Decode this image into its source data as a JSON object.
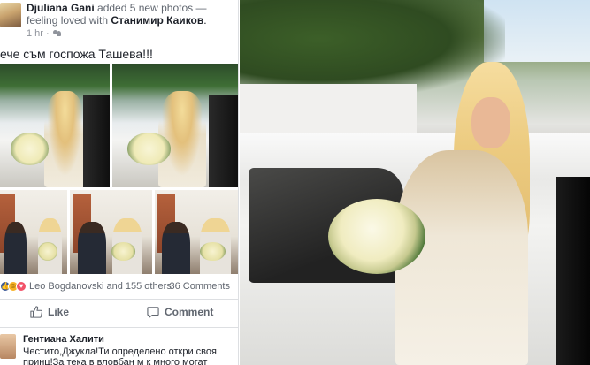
{
  "post": {
    "author": "Djuliana Gani",
    "action": "added 5 new photos —",
    "feeling": "feeling loved with",
    "tagged": "Станимир Каиков",
    "tagged_suffix": ".",
    "time": "1 hr ·",
    "text": "ече съм госпожа Ташева!!!",
    "reactions_text": "Leo Bogdanovski and 155 others",
    "comments_count": "36 Comments",
    "like_label": "Like",
    "comment_label": "Comment"
  },
  "comment": {
    "author": "Гентиана Халити",
    "text": "Честито,Джукла!Ти определено откри своя принц!За тека в вловбан м к много могат"
  },
  "icons": {
    "audience": "friends-icon",
    "like": "thumbs-up-icon",
    "comment": "speech-bubble-icon",
    "reactions": [
      "like-reaction-icon",
      "haha-reaction-icon",
      "love-reaction-icon"
    ]
  },
  "colors": {
    "facebook_blue": "#3b5998",
    "muted_text": "#616770",
    "divider": "#dddfe2"
  }
}
